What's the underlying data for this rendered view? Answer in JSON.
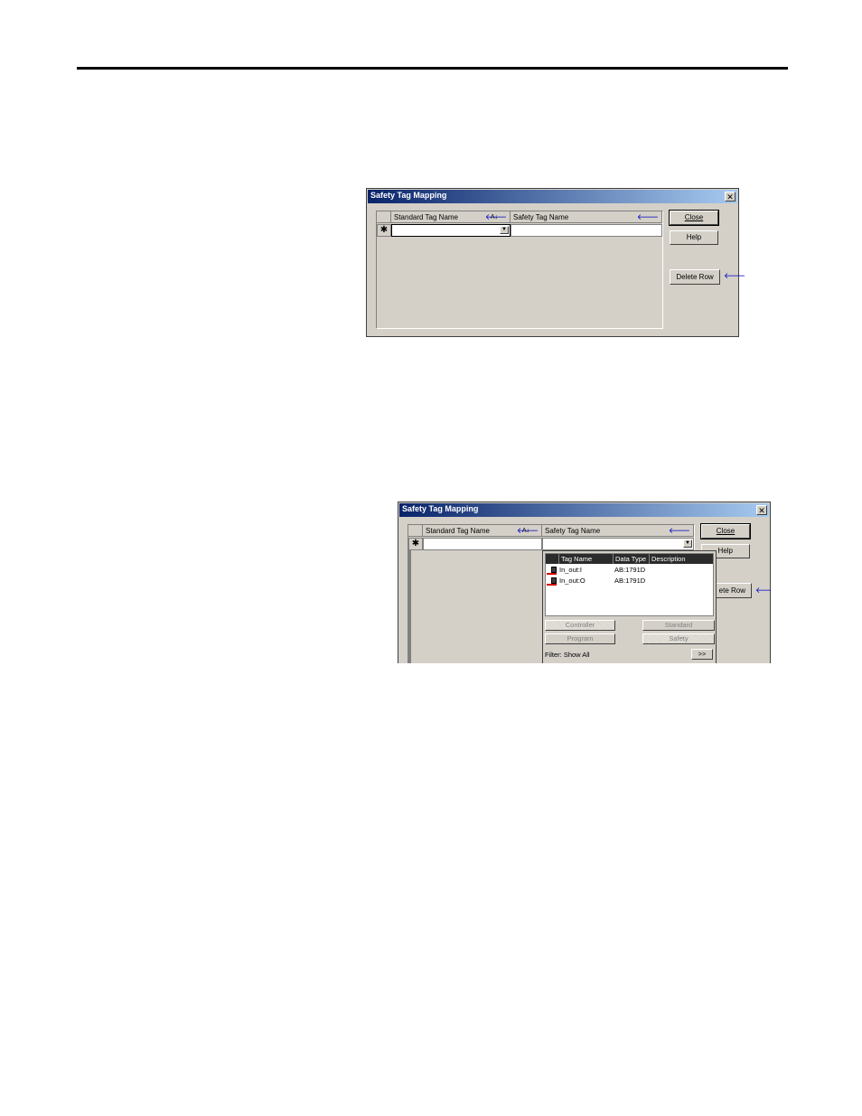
{
  "dialog1": {
    "title": "Safety Tag Mapping",
    "close_x": "✕",
    "col_standard": "Standard Tag Name",
    "col_safety": "Safety Tag Name",
    "sort_glyph": "A↓",
    "col_arrow": "🡐",
    "new_row_marker": "✱",
    "dropdown_glyph": "▼",
    "buttons": {
      "close": "Close",
      "help": "Help",
      "delete_row": "Delete Row"
    },
    "side_arrow": "🡐"
  },
  "dialog2": {
    "title": "Safety Tag Mapping",
    "close_x": "✕",
    "col_standard": "Standard Tag Name",
    "col_safety": "Safety Tag Name",
    "sort_glyph": "A↓",
    "col_arrow": "🡐",
    "new_row_marker": "✱",
    "dropdown_glyph": "▼",
    "buttons": {
      "close": "Close",
      "help": "Help",
      "delete_row": "ete Row"
    },
    "side_arrow": "🡐",
    "popup": {
      "columns": [
        "Tag Name",
        "Data Type",
        "Description"
      ],
      "rows": [
        {
          "tag": "In_out:I",
          "type": "AB:1791D",
          "description": ""
        },
        {
          "tag": "In_out:O",
          "type": "AB:1791D",
          "description": ""
        }
      ],
      "scope_buttons": {
        "controller": "Controller",
        "program": "Program",
        "standard": "Standard",
        "safety": "Safety"
      },
      "filter_label": "Filter: Show All",
      "more_button": ">>"
    }
  }
}
